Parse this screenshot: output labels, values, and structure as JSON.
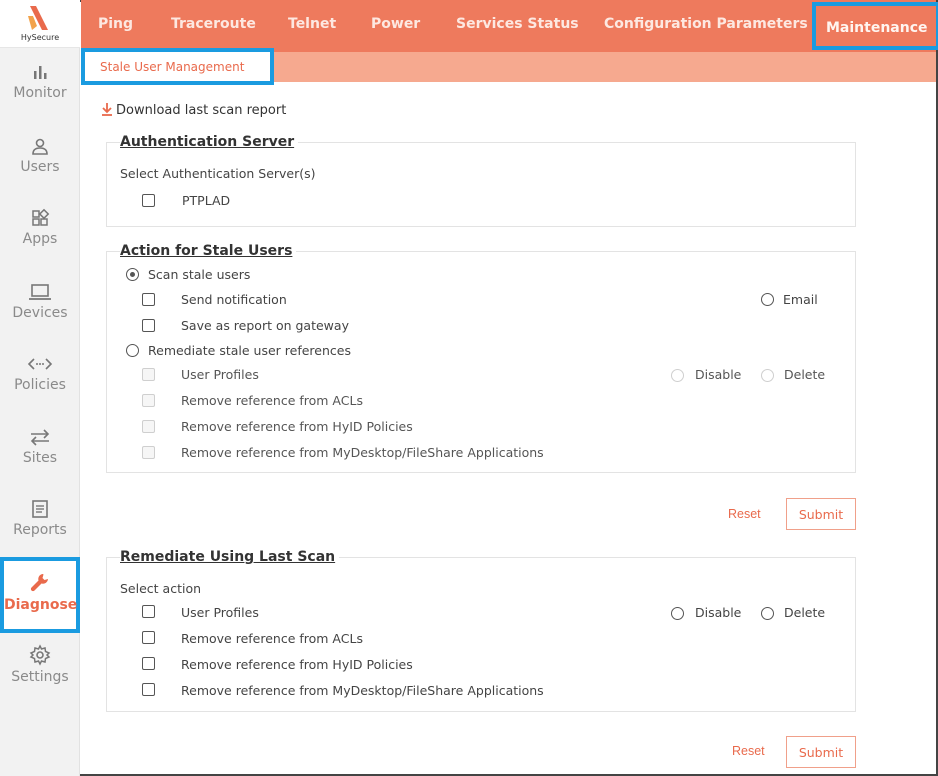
{
  "brand": {
    "name": "HySecure",
    "accent": "#e96a4c",
    "highlight": "#1a9be0"
  },
  "sidebar": {
    "items": [
      {
        "label": "Monitor",
        "icon": "bar-chart-icon"
      },
      {
        "label": "Users",
        "icon": "user-icon"
      },
      {
        "label": "Apps",
        "icon": "apps-grid-icon"
      },
      {
        "label": "Devices",
        "icon": "laptop-icon"
      },
      {
        "label": "Policies",
        "icon": "code-arrows-icon"
      },
      {
        "label": "Sites",
        "icon": "transfer-arrows-icon"
      },
      {
        "label": "Reports",
        "icon": "document-icon"
      },
      {
        "label": "Diagnose",
        "icon": "wrench-icon",
        "active": true
      },
      {
        "label": "Settings",
        "icon": "gear-icon"
      }
    ]
  },
  "topnav": {
    "tabs": [
      {
        "label": "Ping"
      },
      {
        "label": "Traceroute"
      },
      {
        "label": "Telnet"
      },
      {
        "label": "Power"
      },
      {
        "label": "Services Status"
      },
      {
        "label": "Configuration Parameters"
      },
      {
        "label": "Maintenance",
        "active": true
      }
    ]
  },
  "subnav": {
    "active_tab": "Stale User Management"
  },
  "download_link": "Download last scan report",
  "auth_server": {
    "title": "Authentication Server",
    "prompt": "Select Authentication Server(s)",
    "servers": [
      {
        "label": "PTPLAD",
        "checked": false
      }
    ]
  },
  "stale_action": {
    "title": "Action for Stale Users",
    "scan_label": "Scan stale users",
    "send_notification": "Send notification",
    "email": "Email",
    "save_report": "Save as report on gateway",
    "remediate_label": "Remediate stale user references",
    "user_profiles": "User Profiles",
    "disable": "Disable",
    "delete": "Delete",
    "remove_acls": "Remove reference from ACLs",
    "remove_hyid": "Remove reference from HyID Policies",
    "remove_mydesktop": "Remove reference from MyDesktop/FileShare Applications",
    "reset": "Reset",
    "submit": "Submit"
  },
  "remediate_last": {
    "title": "Remediate Using Last Scan",
    "prompt": "Select action",
    "user_profiles": "User Profiles",
    "disable": "Disable",
    "delete": "Delete",
    "remove_acls": "Remove reference from ACLs",
    "remove_hyid": "Remove reference from HyID Policies",
    "remove_mydesktop": "Remove reference from MyDesktop/FileShare Applications",
    "reset": "Reset",
    "submit": "Submit"
  }
}
